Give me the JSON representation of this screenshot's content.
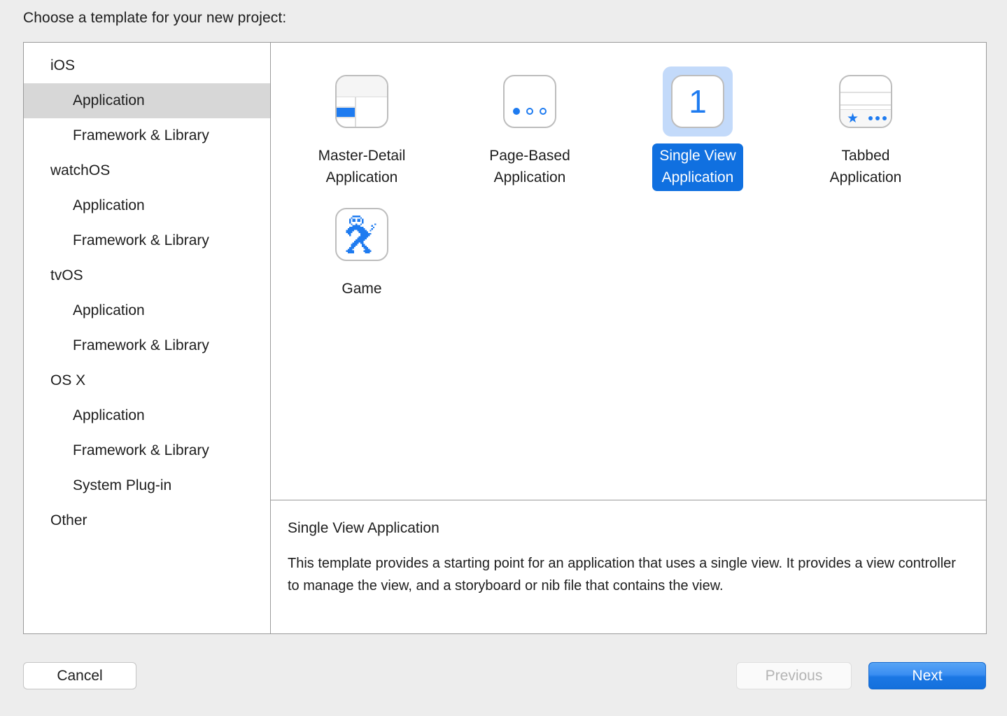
{
  "dialog": {
    "prompt": "Choose a template for your new project:"
  },
  "sidebar": {
    "items": [
      {
        "label": "iOS",
        "level": "group",
        "selected": false
      },
      {
        "label": "Application",
        "level": "child",
        "selected": true
      },
      {
        "label": "Framework & Library",
        "level": "child",
        "selected": false
      },
      {
        "label": "watchOS",
        "level": "group",
        "selected": false
      },
      {
        "label": "Application",
        "level": "child",
        "selected": false
      },
      {
        "label": "Framework & Library",
        "level": "child",
        "selected": false
      },
      {
        "label": "tvOS",
        "level": "group",
        "selected": false
      },
      {
        "label": "Application",
        "level": "child",
        "selected": false
      },
      {
        "label": "Framework & Library",
        "level": "child",
        "selected": false
      },
      {
        "label": "OS X",
        "level": "group",
        "selected": false
      },
      {
        "label": "Application",
        "level": "child",
        "selected": false
      },
      {
        "label": "Framework & Library",
        "level": "child",
        "selected": false
      },
      {
        "label": "System Plug-in",
        "level": "child",
        "selected": false
      },
      {
        "label": "Other",
        "level": "group",
        "selected": false
      }
    ]
  },
  "templates": [
    {
      "label_line1": "Master-Detail",
      "label_line2": "Application",
      "icon": "master-detail-icon",
      "selected": false
    },
    {
      "label_line1": "Page-Based",
      "label_line2": "Application",
      "icon": "page-based-icon",
      "selected": false
    },
    {
      "label_line1": "Single View",
      "label_line2": "Application",
      "icon": "single-view-icon",
      "selected": true
    },
    {
      "label_line1": "Tabbed",
      "label_line2": "Application",
      "icon": "tabbed-icon",
      "selected": false
    },
    {
      "label_line1": "Game",
      "label_line2": "",
      "icon": "game-sprite-icon",
      "selected": false
    }
  ],
  "single_view_icon_number": "1",
  "description": {
    "title": "Single View Application",
    "body": "This template provides a starting point for an application that uses a single view. It provides a view controller to manage the view, and a storyboard or nib file that contains the view."
  },
  "footer": {
    "cancel_label": "Cancel",
    "previous_label": "Previous",
    "next_label": "Next"
  },
  "colors": {
    "accent_blue": "#1e7bf0",
    "selection_blue": "#1070e0",
    "selection_tint": "#c3dafa",
    "sidebar_selection": "#d7d7d7",
    "window_bg": "#ededed",
    "panel_border": "#9a9a9a"
  }
}
